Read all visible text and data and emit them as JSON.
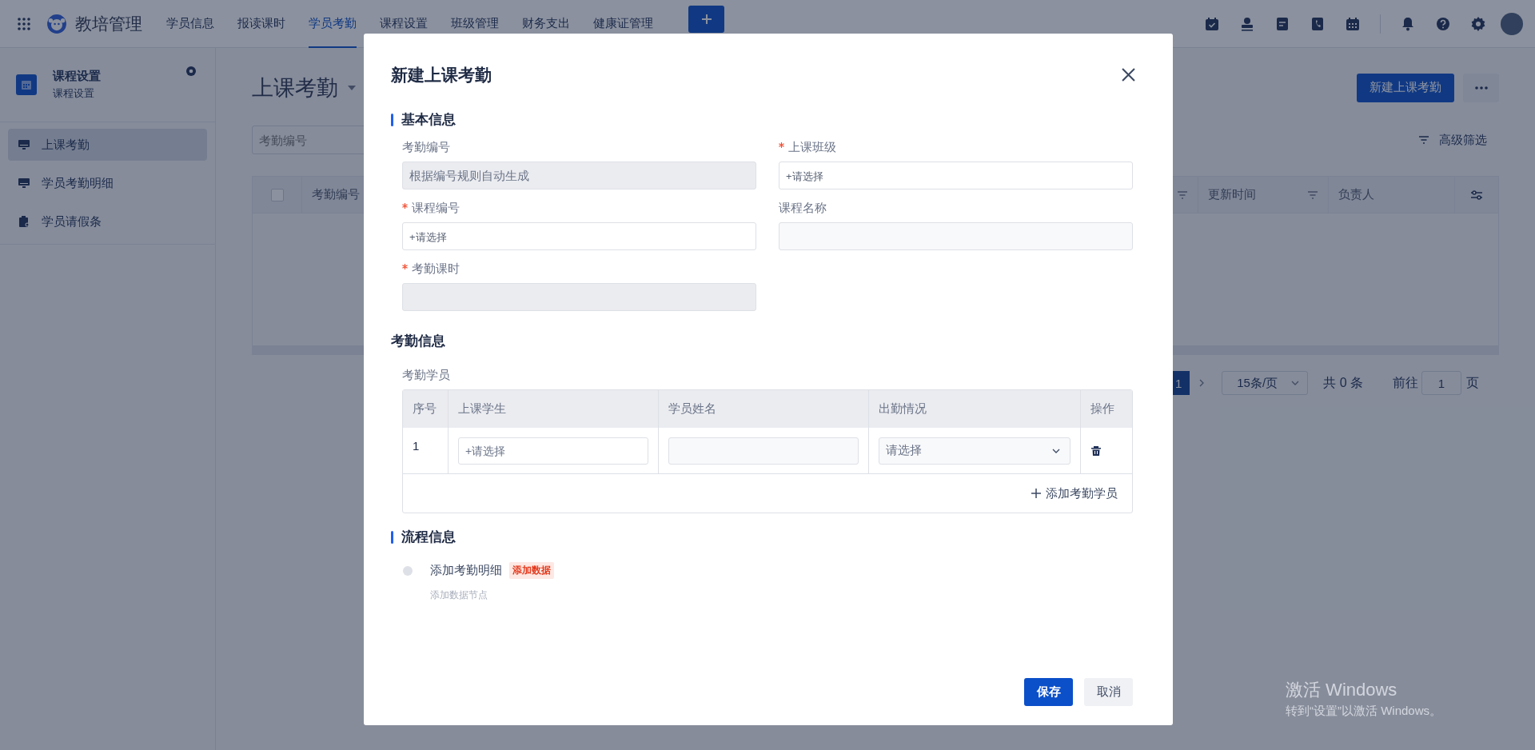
{
  "topbar": {
    "app_name": "教培管理",
    "nav": [
      {
        "label": "学员信息",
        "selected": false
      },
      {
        "label": "报读课时",
        "selected": false
      },
      {
        "label": "学员考勤",
        "selected": true
      },
      {
        "label": "课程设置",
        "selected": false
      },
      {
        "label": "班级管理",
        "selected": false
      },
      {
        "label": "财务支出",
        "selected": false
      },
      {
        "label": "健康证管理",
        "selected": false
      }
    ]
  },
  "sidebar": {
    "title": "课程设置",
    "subtitle": "课程设置",
    "items": [
      {
        "label": "上课考勤",
        "selected": true,
        "kind": "monitor"
      },
      {
        "label": "学员考勤明细",
        "selected": false,
        "kind": "monitor"
      },
      {
        "label": "学员请假条",
        "selected": false,
        "kind": "clipboard"
      }
    ]
  },
  "page": {
    "title": "上课考勤",
    "new_button": "新建上课考勤",
    "search_placeholder": "考勤编号",
    "advanced_filter": "高级筛选",
    "table": {
      "select_all_checked": false,
      "columns": [
        {
          "label": "考勤编号",
          "filterable": true
        },
        {
          "label": "更新时间",
          "filterable": true
        },
        {
          "label": "负责人",
          "filterable": false
        }
      ]
    },
    "pagination": {
      "current_page": "1",
      "page_size": "15条/页",
      "total": "共 0 条",
      "goto_label": "前往",
      "goto_value": "1",
      "page_unit": "页"
    }
  },
  "modal": {
    "title": "新建上课考勤",
    "basic_section": "基本信息",
    "fields": [
      {
        "label": "考勤编号",
        "required": false,
        "kind": "disabled",
        "placeholder": "根据编号规则自动生成"
      },
      {
        "label": "上课班级",
        "required": true,
        "kind": "picker",
        "placeholder": "+请选择"
      },
      {
        "label": "课程编号",
        "required": true,
        "kind": "picker",
        "placeholder": "+请选择"
      },
      {
        "label": "课程名称",
        "required": false,
        "kind": "readonly"
      },
      {
        "label": "考勤课时",
        "required": true,
        "kind": "disabled"
      }
    ],
    "attendance_section": "考勤信息",
    "students_label": "考勤学员",
    "students_table": {
      "columns": [
        "序号",
        "上课学生",
        "学员姓名",
        "出勤情况",
        "操作"
      ],
      "rows": [
        {
          "index": "1",
          "student_placeholder": "+请选择",
          "status_placeholder": "请选择"
        }
      ],
      "add_label": "添加考勤学员"
    },
    "process_section": "流程信息",
    "steps": [
      {
        "name": "添加考勤明细",
        "tag": "添加数据",
        "note": "添加数据节点"
      }
    ],
    "save_button": "保存",
    "cancel_button": "取消"
  },
  "os_watermark": {
    "title": "激活 Windows",
    "subtitle": "转到“设置”以激活 Windows。"
  }
}
